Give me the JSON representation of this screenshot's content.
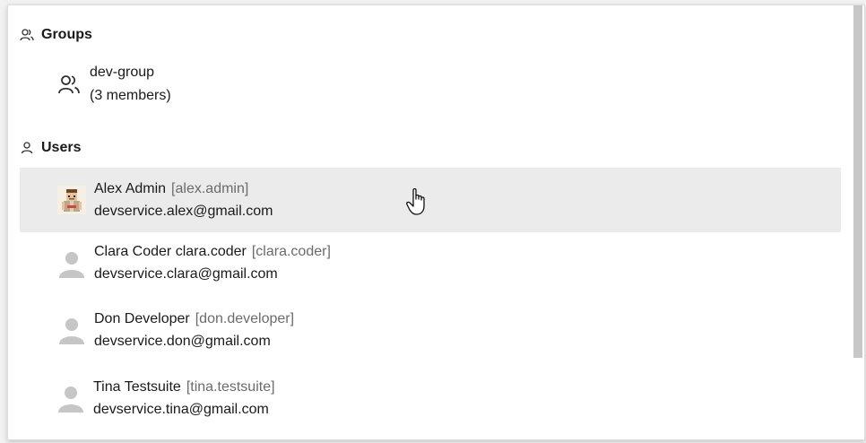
{
  "groups_section": {
    "title": "Groups",
    "icon": "users-icon",
    "items": [
      {
        "name": "dev-group",
        "members": "(3 members)",
        "icon": "users-icon"
      }
    ]
  },
  "users_section": {
    "title": "Users",
    "icon": "user-icon",
    "items": [
      {
        "name": "Alex Admin",
        "login": "[alex.admin]",
        "email": "devservice.alex@gmail.com",
        "avatar": "custom-avatar"
      },
      {
        "name": "Clara Coder clara.coder",
        "login": "[clara.coder]",
        "email": "devservice.clara@gmail.com",
        "avatar": "default-avatar"
      },
      {
        "name": "Don Developer",
        "login": "[don.developer]",
        "email": "devservice.don@gmail.com",
        "avatar": "default-avatar"
      },
      {
        "name": "Tina Testsuite",
        "login": "[tina.testsuite]",
        "email": "devservice.tina@gmail.com",
        "avatar": "default-avatar"
      }
    ]
  },
  "colors": {
    "hover_row": "#ebebeb",
    "login_text": "#6b6b6b",
    "default_avatar": "#c6c6c6"
  }
}
